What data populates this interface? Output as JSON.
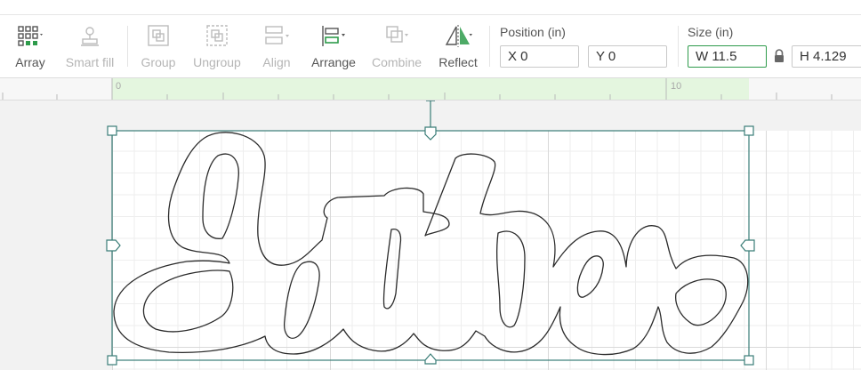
{
  "toolbar": {
    "tools": [
      {
        "label": "Array",
        "icon": "array-icon",
        "enabled": true
      },
      {
        "label": "Smart fill",
        "icon": "smart-fill-icon",
        "enabled": false
      },
      {
        "label": "Group",
        "icon": "group-icon",
        "enabled": false
      },
      {
        "label": "Ungroup",
        "icon": "ungroup-icon",
        "enabled": false
      },
      {
        "label": "Align",
        "icon": "align-icon",
        "enabled": false
      },
      {
        "label": "Arrange",
        "icon": "arrange-icon",
        "enabled": true
      },
      {
        "label": "Combine",
        "icon": "combine-icon",
        "enabled": false
      },
      {
        "label": "Reflect",
        "icon": "reflect-icon",
        "enabled": true
      }
    ],
    "position": {
      "label": "Position (in)",
      "x": "X 0",
      "y": "Y 0"
    },
    "size": {
      "label": "Size (in)",
      "w": "W 11.5",
      "h": "H 4.129",
      "locked": true
    }
  },
  "ruler": {
    "marks": [
      "0",
      "10"
    ]
  },
  "colors": {
    "accent": "#2e9b4b",
    "selection": "#3a7d77",
    "ruler_highlight": "#e4f6df"
  }
}
